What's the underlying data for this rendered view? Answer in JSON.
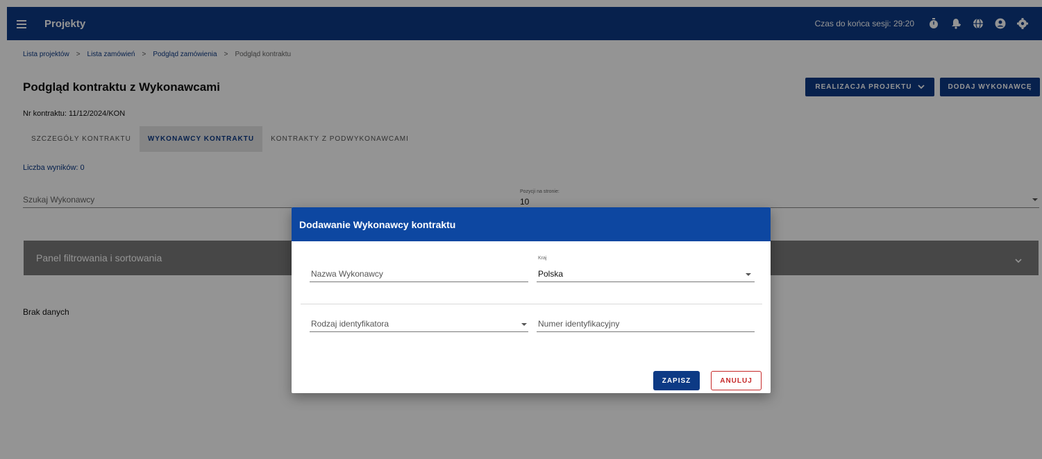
{
  "header": {
    "title": "Projekty",
    "session_label": "Czas do końca sesji: 29:20",
    "icons": [
      "menu-icon",
      "timer-icon",
      "notifications-icon",
      "globe-icon",
      "account-icon",
      "settings-icon"
    ]
  },
  "breadcrumb": {
    "items": [
      "Lista projektów",
      "Lista zamówień",
      "Podgląd zamówienia"
    ],
    "current": "Podgląd kontraktu",
    "separator": ">"
  },
  "page": {
    "title": "Podgląd kontraktu z Wykonawcami",
    "contract_no": "Nr kontraktu: 11/12/2024/KON",
    "realization_button": "REALIZACJA PROJEKTU",
    "add_button": "DODAJ WYKONAWCĘ"
  },
  "tabs": [
    {
      "label": "SZCZEGÓŁY KONTRAKTU",
      "active": false
    },
    {
      "label": "WYKONAWCY KONTRAKTU",
      "active": true
    },
    {
      "label": "KONTRAKTY Z PODWYKONAWCAMI",
      "active": false
    }
  ],
  "results": "Liczba wyników: 0",
  "search": {
    "placeholder": "Szukaj Wykonawcy"
  },
  "per_page": {
    "label": "Pozycji na stronie:",
    "value": "10"
  },
  "filter_panel": {
    "title": "Panel filtrowania i sortowania"
  },
  "no_data": "Brak danych",
  "dialog": {
    "title": "Dodawanie Wykonawcy kontraktu",
    "name_placeholder": "Nazwa Wykonawcy",
    "country_label": "Kraj",
    "country_value": "Polska",
    "identifier_type_placeholder": "Rodzaj identyfikatora",
    "identifier_number_placeholder": "Numer identyfikacyjny",
    "save_label": "ZAPISZ",
    "cancel_label": "ANULUJ"
  },
  "colors": {
    "primary": "#0d3a85",
    "dialog_header": "#0d47a1",
    "cancel": "#c62828",
    "filter_panel": "#7a7a7a"
  }
}
